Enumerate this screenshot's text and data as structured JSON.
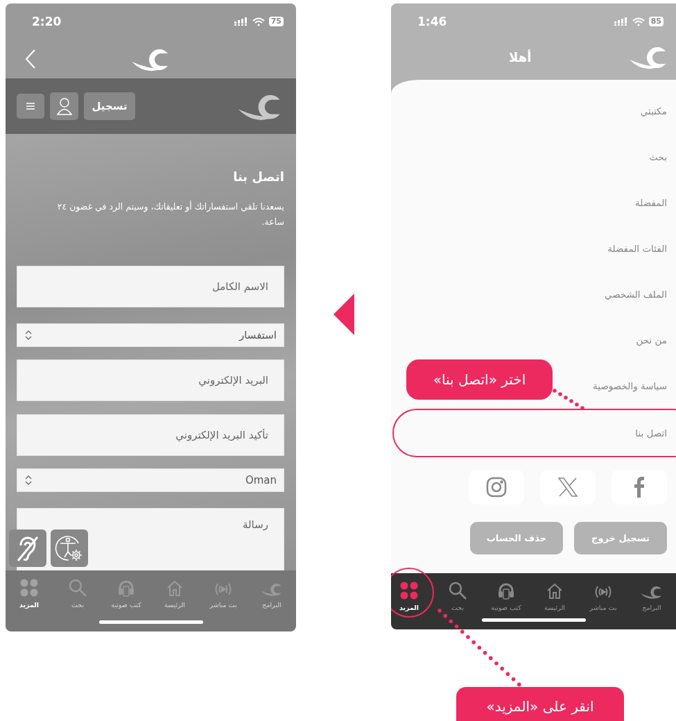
{
  "contact_screen": {
    "status_bar": {
      "time": "2:20",
      "battery": "75"
    },
    "top_bar": {
      "register_button": "تسجيل"
    },
    "title": "اتصل بنا",
    "description": "يسعدنا تلقي استفساراتك أو تعليقاتك، وسيتم الرد في غضون ٢٤ ساعة.",
    "form_fields": [
      {
        "kind": "text",
        "placeholder": "الاسم الكامل"
      },
      {
        "kind": "select",
        "value": "استفسار"
      },
      {
        "kind": "text",
        "placeholder": "البريد الإلكتروني"
      },
      {
        "kind": "text",
        "placeholder": "تأكيد البريد الإلكتروني"
      },
      {
        "kind": "select",
        "value": "Oman"
      },
      {
        "kind": "textarea",
        "placeholder": "رسالة"
      }
    ],
    "bottom_nav": [
      {
        "kind": "logo",
        "label": "البرامج",
        "selected": false
      },
      {
        "kind": "live",
        "label": "بث مباشر",
        "selected": false
      },
      {
        "kind": "home",
        "label": "الرئيسة",
        "selected": false
      },
      {
        "kind": "audiobooks",
        "label": "كتب صوتية",
        "selected": false
      },
      {
        "kind": "search",
        "label": "بحث",
        "selected": false
      },
      {
        "kind": "more",
        "label": "المزيد",
        "selected": true
      }
    ]
  },
  "menu_screen": {
    "status_bar": {
      "time": "1:46",
      "battery": "85"
    },
    "header": {
      "title": "أهلا"
    },
    "menu": [
      {
        "label": "مكتبتي",
        "circled": false
      },
      {
        "label": "بحث",
        "circled": false
      },
      {
        "label": "المفضلة",
        "circled": false
      },
      {
        "label": "الفئات المفضلة",
        "circled": false
      },
      {
        "label": "الملف الشخصي",
        "circled": false
      },
      {
        "label": "من نحن",
        "circled": false
      },
      {
        "label": "سياسة والخصوصية",
        "circled": false
      },
      {
        "label": "اتصل بنا",
        "circled": true
      }
    ],
    "buttons": [
      "تسجيل خروج",
      "حذف الحساب"
    ],
    "bottom_nav": [
      {
        "kind": "logo",
        "label": "البرامج",
        "selected": false,
        "circled": false
      },
      {
        "kind": "live",
        "label": "بث مباشر",
        "selected": false,
        "circled": false
      },
      {
        "kind": "home",
        "label": "الرئيسة",
        "selected": false,
        "circled": false
      },
      {
        "kind": "audiobooks",
        "label": "كتب صوتية",
        "selected": false,
        "circled": false
      },
      {
        "kind": "search",
        "label": "بحث",
        "selected": false,
        "circled": false
      },
      {
        "kind": "more",
        "label": "المزيد",
        "selected": true,
        "circled": true
      }
    ]
  },
  "annotations": [
    "اختر «اتصل بنا»",
    "انقر على «المزيد»"
  ]
}
